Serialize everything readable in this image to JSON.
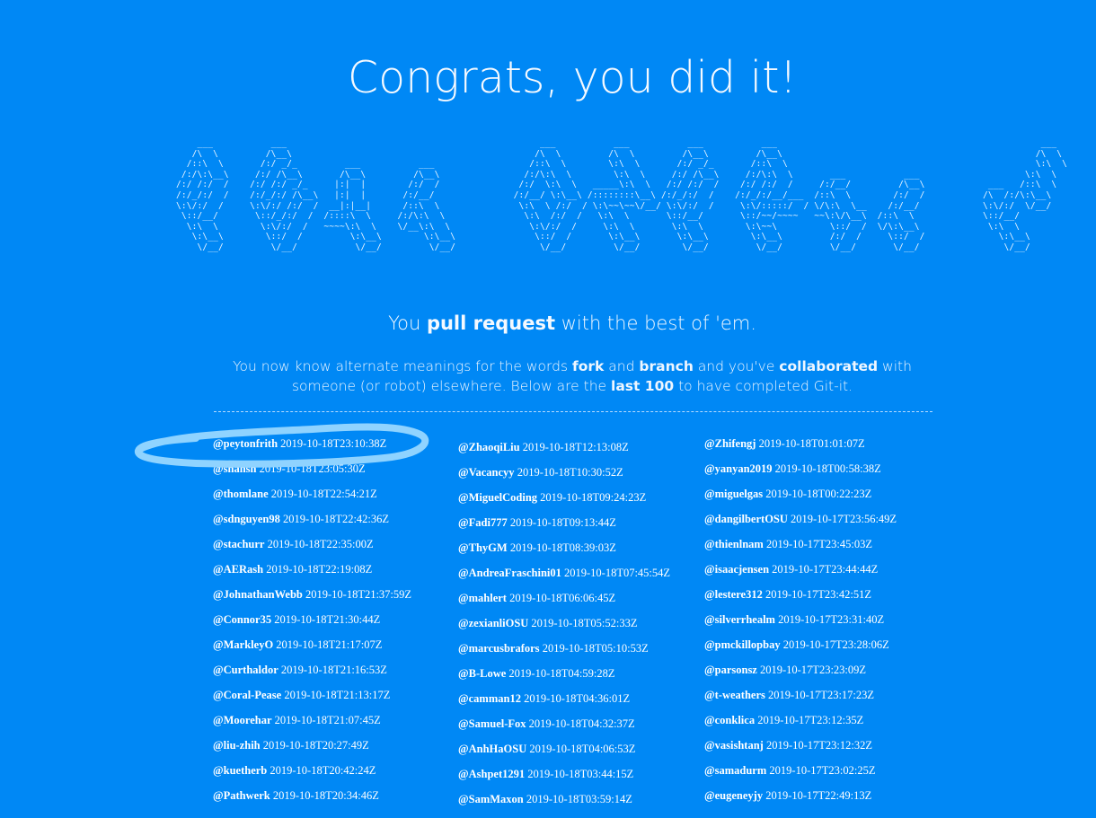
{
  "heading": "Congrats, you did it!",
  "ascii_art": "    ___           ___                                                ___           ___           ___           ___                                                  ___     \n   /\\  \\         /\\__\\                                              /\\  \\         /\\  \\         /\\__\\         /\\__\\                                                /\\  \\    \n  /::\\  \\       /:/ _/_         ___           ___                  /::\\  \\        \\:\\  \\       /:/ _/_       /::\\  \\                                               \\:\\  \\   \n /:/\\:\\__\\     /:/ /\\__\\       /\\__\\         /\\__\\                /:/\\:\\  \\        \\:\\  \\     /:/ /\\__\\     /:/\\:\\  \\       ___           ___                    \\:\\  \\  \n/:/ /:/  /    /:/ /:/ _/_     |:|  |        /:/  /               /:/  \\:\\  \\   _____\\:\\  \\   /:/ /:/  /    /:/ /:/  /     /:/__/         /\\__\\            ___   /::\\  \\ \n/:/_/:/  /    /:/_/:/ /\\__\\   |:|  |       /:/__/               /:/__/ \\:\\__\\ /::::::::\\__\\ /:/_/:/  /    /:/_/:/__/___  /::\\  \\        /:/  /           /\\  /:/\\:\\__\\\n\\:\\/:/  /     \\:\\/:/ /:/  /  __|:|__|      /::\\  \\               \\:\\  \\ /:/  / \\:\\~~\\~~\\/__/ \\:\\/:/  /     \\:\\/:::::/  / \\/\\:\\  \\__    /:/__/            \\:\\/:/  \\/__/\n \\::/__/       \\::/_/:/  /  /::::\\  \\     /:/\\:\\  \\               \\:\\  /:/  /   \\:\\  \\       \\::/__/       \\::/~~/~~~~   ~~\\:\\/\\__\\  /::\\  \\             \\::/__/     \n  \\:\\  \\        \\:\\/:/  /   ~~~~\\:\\  \\    \\/__\\:\\  \\               \\:\\/:/  /     \\:\\  \\       \\:\\  \\        \\:\\~~\\          \\::/  /  \\/\\:\\__\\             \\:\\  \\     \n   \\:\\__\\        \\::/  /         \\:\\__\\        \\:\\__\\               \\::/  /       \\:\\__\\       \\:\\__\\        \\:\\__\\         /:/  /     \\::/  /              \\:\\__\\    \n    \\/__/         \\/__/           \\/__/         \\/__/                \\/__/         \\/__/        \\/__/         \\/__/         \\/__/       \\/__/                \\/__/    ",
  "tagline": {
    "pre": "You",
    "bold": "pull request",
    "post": "with the best of 'em."
  },
  "intro": {
    "t1": "You now know alternate meanings for the words",
    "b1": "fork",
    "t2": "and",
    "b2": "branch",
    "t3": "and you've",
    "b3": "collaborated",
    "t4": "with someone (or robot) elsewhere. Below are the",
    "b4": "last 100",
    "t5": "to have completed Git-it."
  },
  "completions": {
    "col1": [
      {
        "user": "@peytonfrith",
        "time": "2019-10-18T23:10:38Z"
      },
      {
        "user": "@shahsn",
        "time": "2019-10-18T23:05:30Z"
      },
      {
        "user": "@thomlane",
        "time": "2019-10-18T22:54:21Z"
      },
      {
        "user": "@sdnguyen98",
        "time": "2019-10-18T22:42:36Z"
      },
      {
        "user": "@stachurr",
        "time": "2019-10-18T22:35:00Z"
      },
      {
        "user": "@AERash",
        "time": "2019-10-18T22:19:08Z"
      },
      {
        "user": "@JohnathanWebb",
        "time": "2019-10-18T21:37:59Z"
      },
      {
        "user": "@Connor35",
        "time": "2019-10-18T21:30:44Z"
      },
      {
        "user": "@MarkleyO",
        "time": "2019-10-18T21:17:07Z"
      },
      {
        "user": "@Curthaldor",
        "time": "2019-10-18T21:16:53Z"
      },
      {
        "user": "@Coral-Pease",
        "time": "2019-10-18T21:13:17Z"
      },
      {
        "user": "@Moorehar",
        "time": "2019-10-18T21:07:45Z"
      },
      {
        "user": "@liu-zhih",
        "time": "2019-10-18T20:27:49Z"
      },
      {
        "user": "@kuetherb",
        "time": "2019-10-18T20:42:24Z"
      },
      {
        "user": "@Pathwerk",
        "time": "2019-10-18T20:34:46Z"
      }
    ],
    "col2": [
      {
        "user": "@ZhaoqiLiu",
        "time": "2019-10-18T12:13:08Z"
      },
      {
        "user": "@Vacancyy",
        "time": "2019-10-18T10:30:52Z"
      },
      {
        "user": "@MiguelCoding",
        "time": "2019-10-18T09:24:23Z"
      },
      {
        "user": "@Fadi777",
        "time": "2019-10-18T09:13:44Z"
      },
      {
        "user": "@ThyGM",
        "time": "2019-10-18T08:39:03Z"
      },
      {
        "user": "@AndreaFraschini01",
        "time": "2019-10-18T07:45:54Z"
      },
      {
        "user": "@mahlert",
        "time": "2019-10-18T06:06:45Z"
      },
      {
        "user": "@zexianliOSU",
        "time": "2019-10-18T05:52:33Z"
      },
      {
        "user": "@marcusbrafors",
        "time": "2019-10-18T05:10:53Z"
      },
      {
        "user": "@B-Lowe",
        "time": "2019-10-18T04:59:28Z"
      },
      {
        "user": "@camman12",
        "time": "2019-10-18T04:36:01Z"
      },
      {
        "user": "@Samuel-Fox",
        "time": "2019-10-18T04:32:37Z"
      },
      {
        "user": "@AnhHaOSU",
        "time": "2019-10-18T04:06:53Z"
      },
      {
        "user": "@Ashpet1291",
        "time": "2019-10-18T03:44:15Z"
      },
      {
        "user": "@SamMaxon",
        "time": "2019-10-18T03:59:14Z"
      }
    ],
    "col3": [
      {
        "user": "@Zhifengj",
        "time": "2019-10-18T01:01:07Z"
      },
      {
        "user": "@yanyan2019",
        "time": "2019-10-18T00:58:38Z"
      },
      {
        "user": "@miguelgas",
        "time": "2019-10-18T00:22:23Z"
      },
      {
        "user": "@dangilbertOSU",
        "time": "2019-10-17T23:56:49Z"
      },
      {
        "user": "@thienlnam",
        "time": "2019-10-17T23:45:03Z"
      },
      {
        "user": "@isaacjensen",
        "time": "2019-10-17T23:44:44Z"
      },
      {
        "user": "@lestere312",
        "time": "2019-10-17T23:42:51Z"
      },
      {
        "user": "@silverrhealm",
        "time": "2019-10-17T23:31:40Z"
      },
      {
        "user": "@pmckillopbay",
        "time": "2019-10-17T23:28:06Z"
      },
      {
        "user": "@parsonsz",
        "time": "2019-10-17T23:23:09Z"
      },
      {
        "user": "@t-weathers",
        "time": "2019-10-17T23:17:23Z"
      },
      {
        "user": "@conklica",
        "time": "2019-10-17T23:12:35Z"
      },
      {
        "user": "@vasishtanj",
        "time": "2019-10-17T23:12:32Z"
      },
      {
        "user": "@samadurm",
        "time": "2019-10-17T23:02:25Z"
      },
      {
        "user": "@eugeneyjy",
        "time": "2019-10-17T22:49:13Z"
      }
    ]
  },
  "colors": {
    "background": "#0088f5",
    "text": "#ffffff",
    "highlight": "#8fd3ff"
  }
}
